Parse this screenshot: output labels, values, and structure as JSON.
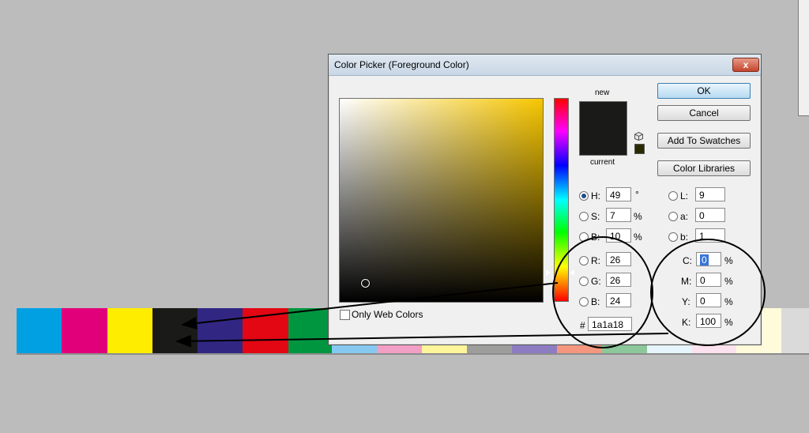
{
  "dialog": {
    "title": "Color Picker (Foreground Color)",
    "close_label": "x",
    "ok_label": "OK",
    "cancel_label": "Cancel",
    "swatches_label": "Add To Swatches",
    "libraries_label": "Color Libraries",
    "new_label": "new",
    "current_label": "current",
    "web_colors_label": "Only Web Colors",
    "hex_prefix": "#",
    "hex_value": "1a1a18",
    "selected_color": "#1a1a18",
    "hue_base_color": "#f7c600"
  },
  "hsb": [
    {
      "label": "H:",
      "value": "49",
      "unit": "°",
      "selected": true
    },
    {
      "label": "S:",
      "value": "7",
      "unit": "%"
    },
    {
      "label": "B:",
      "value": "10",
      "unit": "%"
    }
  ],
  "rgb": [
    {
      "label": "R:",
      "value": "26"
    },
    {
      "label": "G:",
      "value": "26"
    },
    {
      "label": "B:",
      "value": "24"
    }
  ],
  "lab": [
    {
      "label": "L:",
      "value": "9"
    },
    {
      "label": "a:",
      "value": "0"
    },
    {
      "label": "b:",
      "value": "1"
    }
  ],
  "cmyk": [
    {
      "label": "C:",
      "value": "0",
      "unit": "%"
    },
    {
      "label": "M:",
      "value": "0",
      "unit": "%"
    },
    {
      "label": "Y:",
      "value": "0",
      "unit": "%"
    },
    {
      "label": "K:",
      "value": "100",
      "unit": "%"
    }
  ],
  "background_swatches": {
    "top_colors": [
      "#00a0e3",
      "#e2007a",
      "#ffed00",
      "#1a1a18",
      "#312783",
      "#e30613",
      "#009640"
    ],
    "bottom_colors": [
      "#85c9f0",
      "#f29fc5",
      "#fff59b",
      "#9d9d9c",
      "#8e7cc3",
      "#f4977e",
      "#8cc89b",
      "#e6f4fb",
      "#fbe2ee"
    ],
    "right_colors": [
      "#fffbdb",
      "#dadada"
    ]
  }
}
